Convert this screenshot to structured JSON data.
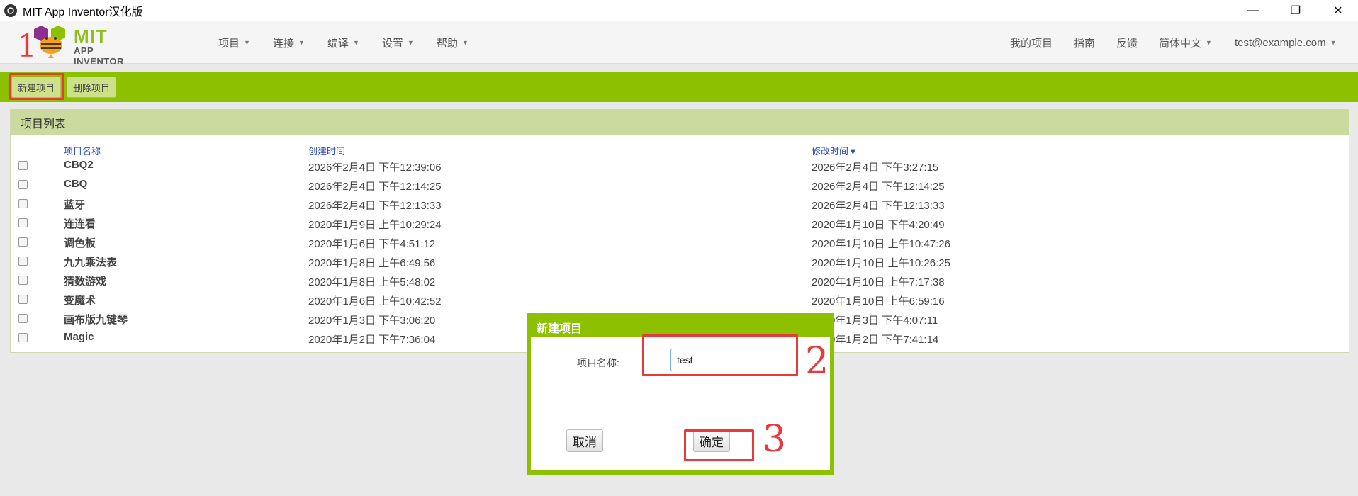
{
  "window": {
    "title": "MIT App Inventor汉化版",
    "controls": [
      "—",
      "❐",
      "✕"
    ]
  },
  "header": {
    "logo": {
      "mit": "MIT",
      "sub": "APP INVENTOR"
    },
    "menus": [
      {
        "label": "项目"
      },
      {
        "label": "连接"
      },
      {
        "label": "编译"
      },
      {
        "label": "设置"
      },
      {
        "label": "帮助"
      }
    ],
    "right": {
      "my_projects": "我的项目",
      "guide": "指南",
      "feedback": "反馈",
      "language": "简体中文",
      "account": "test@example.com"
    }
  },
  "toolbar": {
    "new_project": "新建项目",
    "delete_project": "删除项目"
  },
  "project_list": {
    "title": "项目列表",
    "columns": {
      "name": "项目名称",
      "created": "创建时间",
      "modified": "修改时间"
    },
    "sort_indicator": "▼",
    "rows": [
      {
        "name": "CBQ2",
        "created": "2026年2月4日 下午12:39:06",
        "modified": "2026年2月4日 下午3:27:15"
      },
      {
        "name": "CBQ",
        "created": "2026年2月4日 下午12:14:25",
        "modified": "2026年2月4日 下午12:14:25"
      },
      {
        "name": "蓝牙",
        "created": "2026年2月4日 下午12:13:33",
        "modified": "2026年2月4日 下午12:13:33"
      },
      {
        "name": "连连看",
        "created": "2020年1月9日 上午10:29:24",
        "modified": "2020年1月10日 下午4:20:49"
      },
      {
        "name": "调色板",
        "created": "2020年1月6日 下午4:51:12",
        "modified": "2020年1月10日 上午10:47:26"
      },
      {
        "name": "九九乘法表",
        "created": "2020年1月8日 上午6:49:56",
        "modified": "2020年1月10日 上午10:26:25"
      },
      {
        "name": "猜数游戏",
        "created": "2020年1月8日 上午5:48:02",
        "modified": "2020年1月10日 上午7:17:38"
      },
      {
        "name": "变魔术",
        "created": "2020年1月6日 上午10:42:52",
        "modified": "2020年1月10日 上午6:59:16"
      },
      {
        "name": "画布版九键琴",
        "created": "2020年1月3日 下午3:06:20",
        "modified": "2020年1月3日 下午4:07:11"
      },
      {
        "name": "Magic",
        "created": "2020年1月2日 下午7:36:04",
        "modified": "2020年1月2日 下午7:41:14"
      }
    ]
  },
  "dialog": {
    "title": "新建项目",
    "name_label": "项目名称:",
    "name_value": "test",
    "cancel": "取消",
    "ok": "确定"
  },
  "annotations": [
    "1",
    "2",
    "3"
  ],
  "colors": {
    "accent_green": "#8dc100",
    "annotation_red": "#e8393c"
  }
}
